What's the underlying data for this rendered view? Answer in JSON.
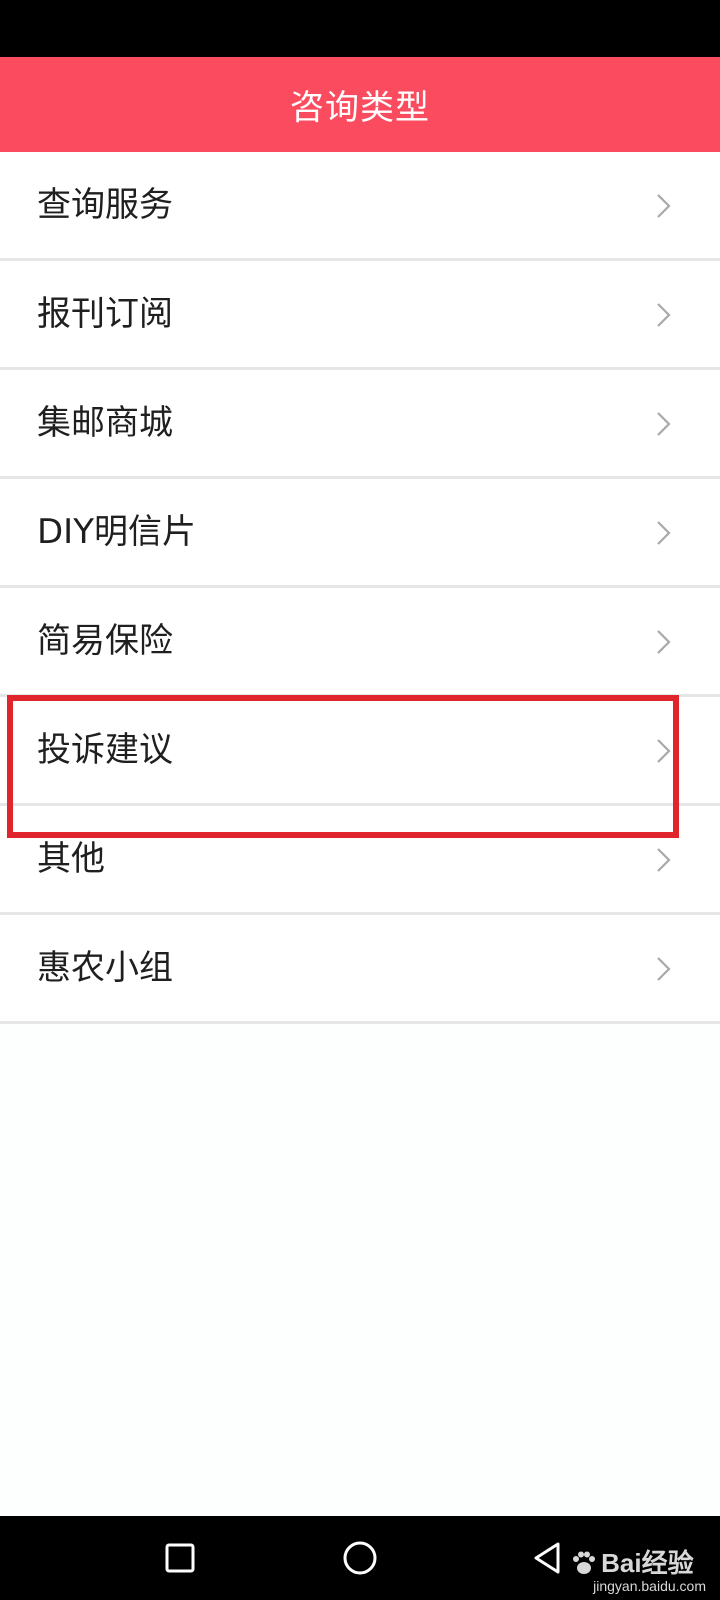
{
  "header": {
    "title": "咨询类型",
    "background_color": "#fb4b5f"
  },
  "list": {
    "items": [
      {
        "label": "查询服务"
      },
      {
        "label": "报刊订阅"
      },
      {
        "label": "集邮商城"
      },
      {
        "label": "DIY明信片"
      },
      {
        "label": "简易保险"
      },
      {
        "label": "投诉建议"
      },
      {
        "label": "其他"
      },
      {
        "label": "惠农小组"
      }
    ],
    "chevron_icon": "chevron-right-icon",
    "highlighted_item": "投诉建议",
    "highlight_color": "#e1252d"
  },
  "nav_bar": {
    "recent_icon": "square-icon",
    "home_icon": "circle-icon",
    "back_icon": "triangle-left-icon"
  },
  "watermark": {
    "brand": "Bai经验",
    "url": "jingyan.baidu.com"
  }
}
